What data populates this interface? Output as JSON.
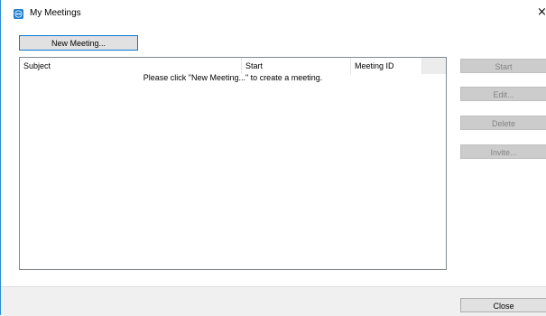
{
  "window": {
    "title": "My Meetings",
    "close_glyph": "×"
  },
  "toolbar": {
    "new_meeting_label": "New Meeting..."
  },
  "list": {
    "columns": [
      "Subject",
      "Start",
      "Meeting ID"
    ],
    "empty_message": "Please click \"New Meeting...\" to create a meeting."
  },
  "side_buttons": {
    "start_label": "Start",
    "edit_label": "Edit...",
    "delete_label": "Delete",
    "invite_label": "Invite..."
  },
  "footer": {
    "close_label": "Close"
  },
  "icons": {
    "app": "teamviewer-icon",
    "close": "close-icon"
  },
  "colors": {
    "accent": "#0a78d7",
    "disabled_button": "#cccccc",
    "disabled_text": "#838383"
  }
}
